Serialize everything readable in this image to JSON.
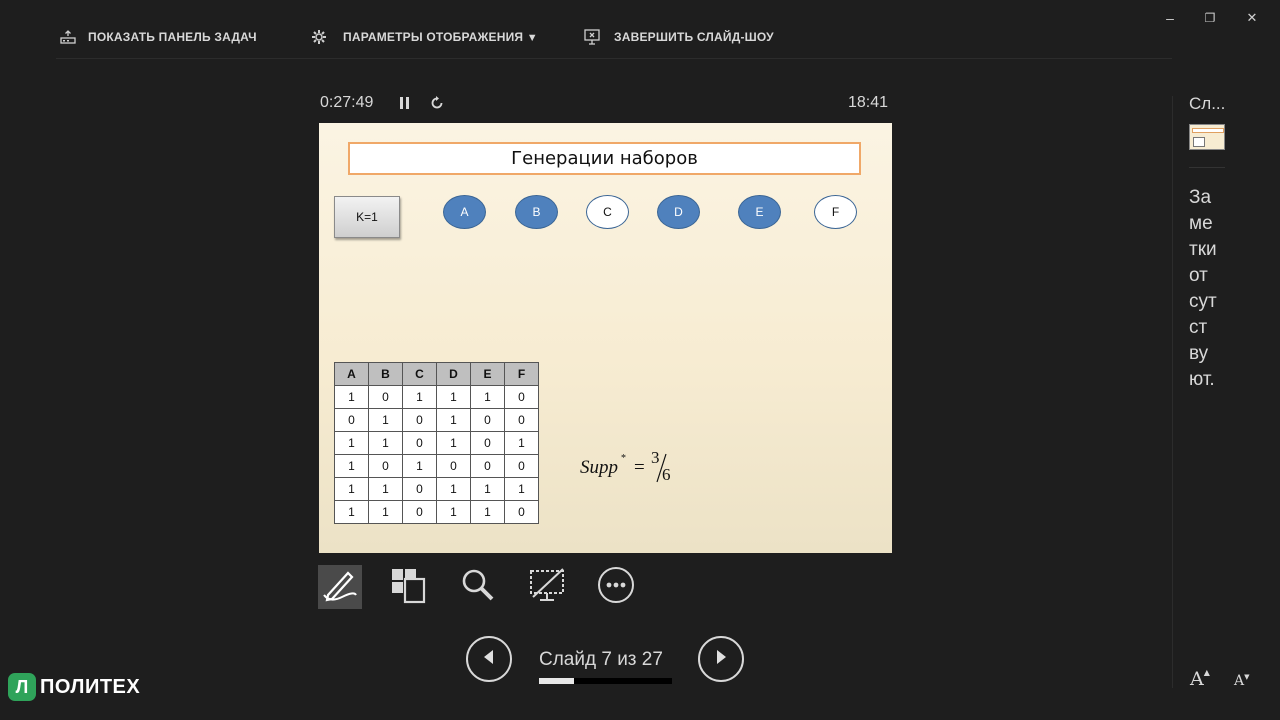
{
  "toolbar": {
    "taskbar_label": "ПОКАЗАТЬ ПАНЕЛЬ ЗАДАЧ",
    "display_label": "ПАРАМЕТРЫ ОТОБРАЖЕНИЯ",
    "display_arrow": "▼",
    "end_label": "ЗАВЕРШИТЬ СЛАЙД-ШОУ"
  },
  "window": {
    "minimize": "–",
    "restore": "❐",
    "close": "✕"
  },
  "timer": {
    "elapsed": "0:27:49",
    "clock": "18:41"
  },
  "slide": {
    "title": "Генерации наборов",
    "k_button": "K=1",
    "nodes": [
      {
        "label": "A",
        "state": "filled"
      },
      {
        "label": "B",
        "state": "filled"
      },
      {
        "label": "C",
        "state": "empty"
      },
      {
        "label": "D",
        "state": "filled"
      },
      {
        "label": "E",
        "state": "filled"
      },
      {
        "label": "F",
        "state": "empty"
      }
    ],
    "table": {
      "headers": [
        "A",
        "B",
        "C",
        "D",
        "E",
        "F"
      ],
      "rows": [
        [
          "1",
          "0",
          "1",
          "1",
          "1",
          "0"
        ],
        [
          "0",
          "1",
          "0",
          "1",
          "0",
          "0"
        ],
        [
          "1",
          "1",
          "0",
          "1",
          "0",
          "1"
        ],
        [
          "1",
          "0",
          "1",
          "0",
          "0",
          "0"
        ],
        [
          "1",
          "1",
          "0",
          "1",
          "1",
          "1"
        ],
        [
          "1",
          "1",
          "0",
          "1",
          "1",
          "0"
        ]
      ]
    },
    "formula": {
      "lhs": "Supp",
      "sup": "*",
      "eq": "=",
      "numerator": "3",
      "denominator": "6"
    }
  },
  "navigation": {
    "slide_label": "Слайд 7 из 27",
    "current": 7,
    "total": 27,
    "progress": 0.26
  },
  "notes": {
    "header": "Сл...",
    "text": "Заметки отсутствуют."
  },
  "font_controls": {
    "increase": "A",
    "decrease": "A"
  },
  "logo": {
    "text": "ПОЛИТЕХ",
    "mark": "Л"
  },
  "colors": {
    "background": "#1e1e1e",
    "node_fill": "#4f81bd",
    "title_border": "#f0a868",
    "logo_green": "#2fa35a"
  }
}
